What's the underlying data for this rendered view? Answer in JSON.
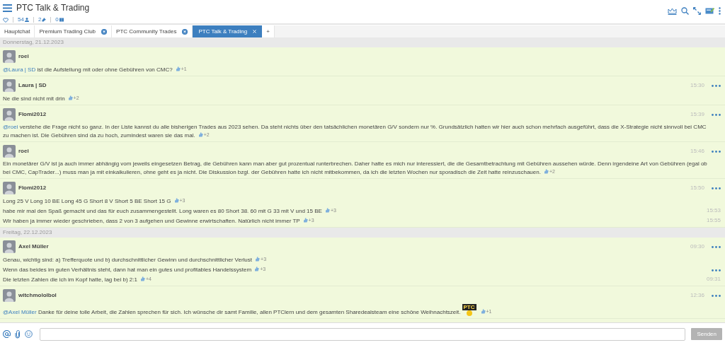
{
  "header": {
    "title": "PTC Talk & Trading",
    "members": "54",
    "pinned": "2",
    "files": "0"
  },
  "tabs": [
    {
      "label": "Hauptchat",
      "selected": false,
      "closable": false
    },
    {
      "label": "Premium Trading Club",
      "selected": false,
      "closable": true
    },
    {
      "label": "PTC Community Trades",
      "selected": false,
      "closable": true
    },
    {
      "label": "PTC Talk & Trading",
      "selected": true,
      "closable": true
    },
    {
      "label": "+",
      "selected": false,
      "closable": false
    }
  ],
  "feed": [
    {
      "kind": "date",
      "text": "Donnerstag, 21.12.2023"
    },
    {
      "kind": "message",
      "author": "roei",
      "lines": [
        {
          "mention": "@Laura | SD",
          "text": "ist die Aufstellung mit oder ohne Gebühren von CMC?",
          "reactions": "+1",
          "menu": false
        }
      ]
    },
    {
      "kind": "message",
      "author": "Laura | SD",
      "time": "15:30",
      "lines": [
        {
          "text": "Ne die sind nicht mit drin",
          "reactions": "+2",
          "menu": false
        }
      ]
    },
    {
      "kind": "message",
      "author": "Flomi2012",
      "time": "15:39",
      "lines": [
        {
          "mention": "@roei",
          "text": "verstehe die Frage nicht so ganz. In der Liste kannst du alle bisherigen Trades aus 2023 sehen. Da steht nichts über den tatsächlichen monetären G/V sondern nur %. Grundsätzlich hatten wir hier auch schon mehrfach ausgeführt, dass die X-Strategie nicht sinnvoll bei CMC zu machen ist. Die Gebühren sind da zu hoch, zumindest waren sie das mal.",
          "reactions": "+2",
          "menu": false
        }
      ]
    },
    {
      "kind": "message",
      "author": "roei",
      "time": "15:46",
      "lines": [
        {
          "text": "Ein monetärer G/V ist ja auch immer abhängig vom jeweils eingesetzen Betrag, die Gebühren kann man aber gut prozentual runterbrechen. Daher hatte es mich nur interessiert, die die Gesamtbetrachtung mit Gebühren aussehen würde. Denn irgendeine Art von Gebühren (egal ob bei CMC, CapTrader...) muss man ja mit einkalkulieren, ohne geht es ja nicht. Die Diskussion bzgl. der Gebühren hatte ich nicht mitbekommen, da ich die letzten Wochen nur sporadisch die Zeit hatte reinzuschauen.",
          "reactions": "+2",
          "menu": false
        }
      ]
    },
    {
      "kind": "message",
      "author": "Flomi2012",
      "time": "15:50",
      "lines": [
        {
          "text": "Long 25 V Long 10 BE Long 45 G Short 8 V Short 5 BE Short 15 G",
          "reactions": "+3",
          "menu": false
        },
        {
          "text": "habe mir mal den Spaß gemacht und das für euch zusammengestellt. Long waren es 80 Short 38. 60 mit G 33 mit V und 15 BE",
          "reactions": "+3",
          "time": "15:53",
          "menu": false
        },
        {
          "text": "Wir haben ja immer wieder geschrieben, dass 2 von 3 aufgehen und Gewinne erwirtschaften. Natürlich nicht immer TP",
          "reactions": "+3",
          "time": "15:55",
          "menu": false
        }
      ]
    },
    {
      "kind": "date",
      "text": "Freitag, 22.12.2023"
    },
    {
      "kind": "message",
      "author": "Axel Müller",
      "time": "09:30",
      "lines": [
        {
          "text": "Genau, wichtig sind: a) Trefferquote und b) durchschnittlicher Gewinn und durchschnittlicher Verlust",
          "reactions": "+3",
          "menu": false
        },
        {
          "text": "Wenn das beides im guten Verhältnis steht, dann hat man ein gutes und profitables Handelssystem",
          "reactions": "+3",
          "menu": true
        },
        {
          "text": "Die letzten Zahlen die ich im Kopf hatte, lag bei b) 2:1",
          "reactions": "+4",
          "time": "09:31",
          "menu": false
        }
      ]
    },
    {
      "kind": "message",
      "author": "witchmololbol",
      "time": "12:36",
      "lines": [
        {
          "mention": "@Axel Müller",
          "text": "Danke für deine tolle Arbeit, die Zahlen sprechen für sich. Ich wünsche dir samt Familie, allen PTClern und dem gesamten Sharedealsteam eine schöne Weihnachtszeit.",
          "sticker": "PTC",
          "reactions": "+1",
          "menu": false
        }
      ]
    }
  ],
  "composer": {
    "send": "Senden"
  }
}
